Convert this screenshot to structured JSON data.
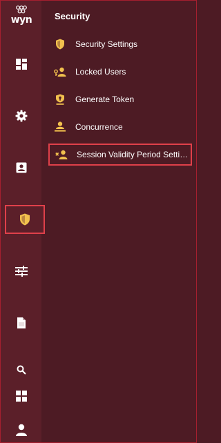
{
  "brand": {
    "logo_text": "wyn"
  },
  "rail": {
    "items": [
      {
        "icon": "dashboard-icon"
      },
      {
        "icon": "gear-icon"
      },
      {
        "icon": "contact-card-icon"
      },
      {
        "icon": "shield-icon",
        "active": true
      },
      {
        "icon": "tune-icon"
      },
      {
        "icon": "document-icon"
      },
      {
        "icon": "search-icon"
      },
      {
        "icon": "apps-icon"
      },
      {
        "icon": "user-icon"
      }
    ]
  },
  "panel": {
    "title": "Security",
    "items": [
      {
        "label": "Security Settings",
        "icon": "shield-icon"
      },
      {
        "label": "Locked Users",
        "icon": "locked-users-icon"
      },
      {
        "label": "Generate Token",
        "icon": "token-icon"
      },
      {
        "label": "Concurrence",
        "icon": "concurrence-icon"
      },
      {
        "label": "Session Validity Period Settin...",
        "icon": "session-user-icon",
        "selected": true
      }
    ]
  },
  "colors": {
    "rail_background": "#5b1f29",
    "panel_background": "#4d1b24",
    "accent_yellow": "#f2c14e",
    "highlight_red": "#e0404a"
  }
}
